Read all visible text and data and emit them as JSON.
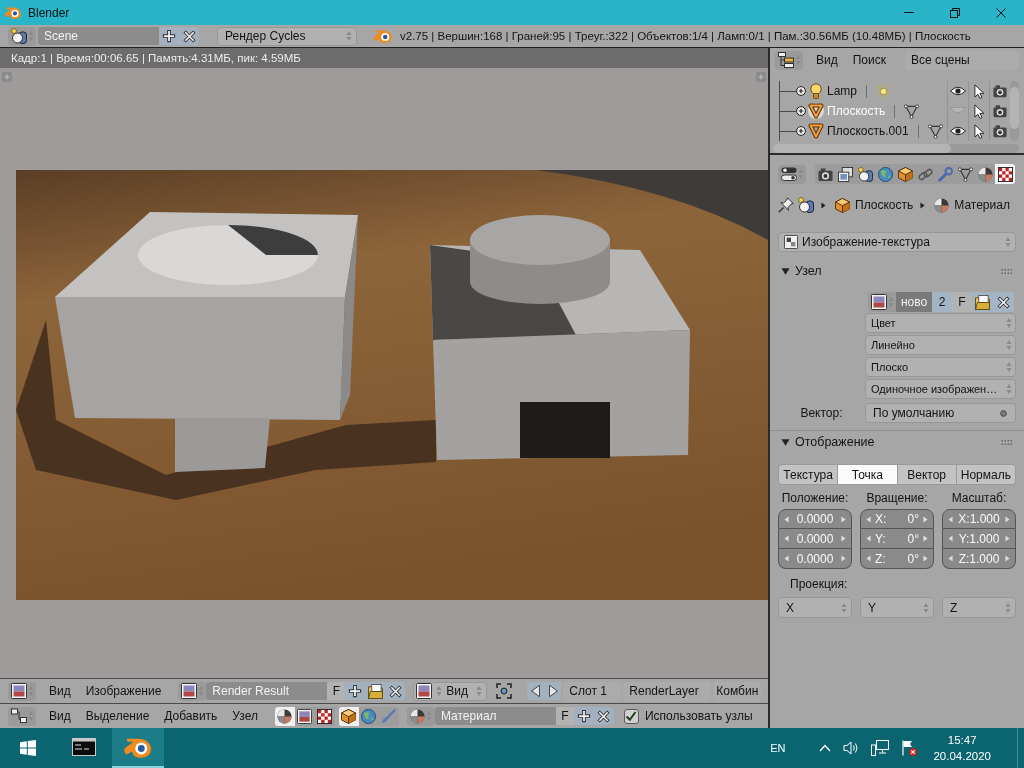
{
  "window": {
    "title": "Blender"
  },
  "info_header": {
    "scene": "Scene",
    "render_engine": "Рендер Cycles",
    "stats": "v2.75 | Вершин:168 | Граней:95 | Треуг.:322 | Объектов:1/4 | Ламп:0/1 | Пам.:30.56МБ (10.48МБ) | Плоскость"
  },
  "image_editor": {
    "render_info": "Кадр:1 | Время:00:06.65 | Память:4.31МБ, пик: 4.59МБ"
  },
  "outliner": {
    "menus": [
      "Вид",
      "Поиск"
    ],
    "display_mode": "Все сцены",
    "rows": [
      {
        "name": "Lamp",
        "kind": "lamp",
        "selected": false,
        "visible": true
      },
      {
        "name": "Плоскость",
        "kind": "mesh",
        "selected": true,
        "visible": false
      },
      {
        "name": "Плоскость.001",
        "kind": "mesh",
        "selected": false,
        "visible": true
      }
    ]
  },
  "properties": {
    "tabs": [
      {
        "kind": "render",
        "selected": false
      },
      {
        "kind": "render_layers",
        "selected": false
      },
      {
        "kind": "scene",
        "selected": false
      },
      {
        "kind": "world",
        "selected": false
      },
      {
        "kind": "object",
        "selected": false
      },
      {
        "kind": "constraints",
        "selected": false
      },
      {
        "kind": "modifiers",
        "selected": false
      },
      {
        "kind": "data",
        "selected": false
      },
      {
        "kind": "material",
        "selected": false
      },
      {
        "kind": "texture",
        "selected": true
      }
    ],
    "breadcrumb": [
      {
        "kind": "object",
        "label": "Плоскость"
      },
      {
        "kind": "material",
        "label": "Материал"
      }
    ],
    "texture_type": "Изображение-текстура",
    "node_panel": {
      "title": "Узел",
      "expanded": true,
      "image_name": "ново",
      "users": "2",
      "fake_user": "F",
      "options": [
        "Цвет",
        "Линейно",
        "Плоско",
        "Одиночное изображен…"
      ],
      "vector_label": "Вектор:",
      "vector_value": "По умолчанию"
    },
    "mapping_panel": {
      "title": "Отображение",
      "expanded": true,
      "tabs": [
        {
          "label": "Текстура",
          "selected": false
        },
        {
          "label": "Точка",
          "selected": true
        },
        {
          "label": "Вектор",
          "selected": false
        },
        {
          "label": "Нормаль",
          "selected": false
        }
      ],
      "columns": [
        {
          "label": "Положение:",
          "fields": [
            {
              "value": "0.0000"
            },
            {
              "value": "0.0000"
            },
            {
              "value": "0.0000"
            }
          ]
        },
        {
          "label": "Вращение:",
          "fields": [
            {
              "axis": "X:",
              "value": "0°"
            },
            {
              "axis": "Y:",
              "value": "0°"
            },
            {
              "axis": "Z:",
              "value": "0°"
            }
          ]
        },
        {
          "label": "Масштаб:",
          "fields": [
            {
              "value": "X:1.000"
            },
            {
              "value": "Y:1.000"
            },
            {
              "value": "Z:1.000"
            }
          ]
        }
      ],
      "projection_label": "Проекция:",
      "projection": [
        "X",
        "Y",
        "Z"
      ]
    }
  },
  "image_header": {
    "menus": [
      "Вид",
      "Изображение"
    ],
    "image_name": "Render Result",
    "fake_user": "F",
    "view": "Вид",
    "slot": "Слот 1",
    "layer": "RenderLayer",
    "pass": "Комбин"
  },
  "node_header": {
    "menus": [
      "Вид",
      "Выделение",
      "Добавить",
      "Узел"
    ],
    "tree_types": [
      {
        "kind": "shader",
        "selected": true
      },
      {
        "kind": "compositing",
        "selected": false
      },
      {
        "kind": "texture",
        "selected": false
      }
    ],
    "shader_types": [
      {
        "kind": "object",
        "selected": true
      },
      {
        "kind": "world",
        "selected": false
      },
      {
        "kind": "line_style",
        "selected": false
      }
    ],
    "material_name": "Материал",
    "fake_user": "F",
    "use_nodes": {
      "label": "Использовать узлы",
      "checked": true
    }
  },
  "taskbar": {
    "apps": [
      {
        "kind": "terminal",
        "active": false
      },
      {
        "kind": "blender",
        "active": true
      }
    ],
    "language": "EN",
    "time": "15:47",
    "date": "20.04.2020"
  }
}
